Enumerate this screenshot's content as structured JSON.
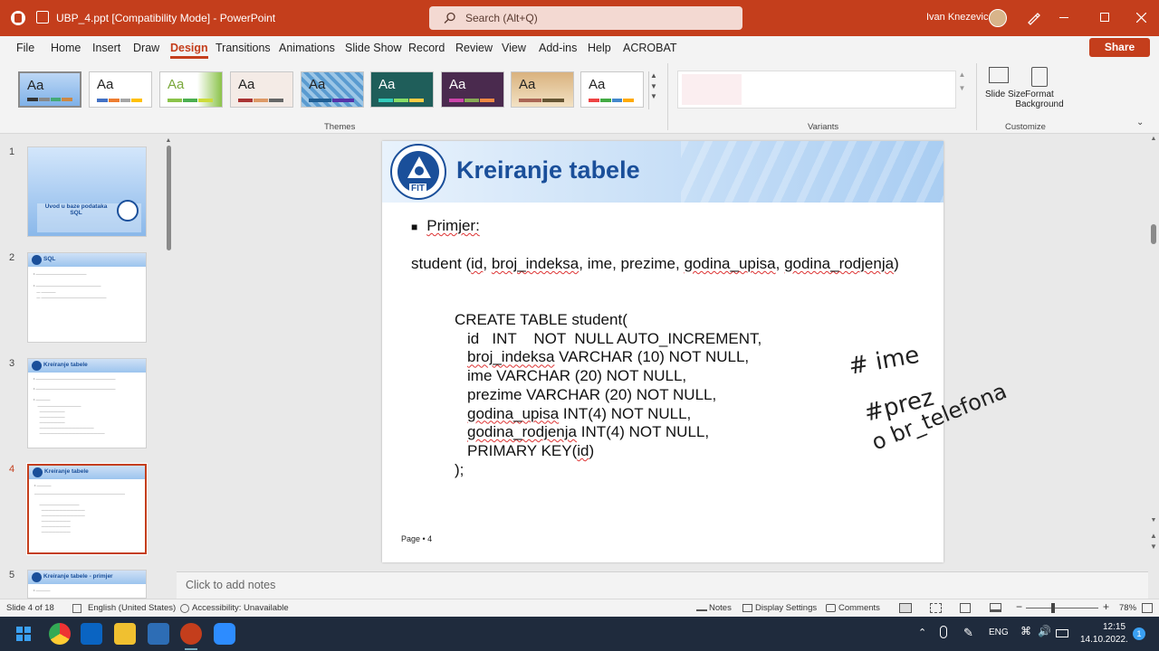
{
  "titlebar": {
    "file_name": "UBP_4.ppt [Compatibility Mode]",
    "separator": " - ",
    "app": "PowerPoint",
    "search_placeholder": "Search (Alt+Q)",
    "user": "Ivan Knezevic"
  },
  "ribbon_tabs": [
    "File",
    "Home",
    "Insert",
    "Draw",
    "Design",
    "Transitions",
    "Animations",
    "Slide Show",
    "Record",
    "Review",
    "View",
    "Add-ins",
    "Help",
    "ACROBAT"
  ],
  "active_tab": "Design",
  "share_label": "Share",
  "ribbon": {
    "themes_label": "Themes",
    "variants_label": "Variants",
    "customize_label": "Customize",
    "theme_sample": "Aa",
    "slide_size": "Slide Size",
    "format_background_1": "Format",
    "format_background_2": "Background"
  },
  "thumbnails": [
    {
      "num": "1",
      "title": "Uvod u baze podataka SQL"
    },
    {
      "num": "2",
      "title": "SQL"
    },
    {
      "num": "3",
      "title": "Kreiranje tabele"
    },
    {
      "num": "4",
      "title": "Kreiranje tabele"
    },
    {
      "num": "5",
      "title": "Kreiranje tabele - primjer"
    }
  ],
  "slide": {
    "title": "Kreiranje tabele",
    "bullet": "Primjer:",
    "student_line_parts": [
      "student (",
      "id",
      ", ",
      "broj_indeksa",
      ", ime, prezime, ",
      "godina_upisa",
      ", ",
      "godina_rodjenja",
      ")"
    ],
    "code": {
      "l1": "CREATE TABLE student(",
      "l2": "id   INT    NOT  NULL AUTO_INCREMENT,",
      "l3a": "broj_indeksa",
      "l3b": " VARCHAR (10) NOT NULL,",
      "l4": "ime VARCHAR (20) NOT NULL,",
      "l5": "prezime VARCHAR (20) NOT NULL,",
      "l6a": "godina_upisa",
      "l6b": " INT(4) NOT NULL,",
      "l7a": "godina_rodjenja",
      "l7b": " INT(4) NOT NULL,",
      "l8a": "PRIMARY KEY(",
      "l8b": "id",
      "l8c": ")",
      "l9": ");"
    },
    "page": "Page • 4",
    "handwriting": [
      "# ime",
      "#prez",
      "o br_telefona"
    ],
    "logo_text": "FIT"
  },
  "notes_placeholder": "Click to add notes",
  "status": {
    "slide": "Slide 4 of 18",
    "language": "English (United States)",
    "accessibility": "Accessibility: Unavailable",
    "notes": "Notes",
    "display_settings": "Display Settings",
    "comments": "Comments",
    "zoom": "78%"
  },
  "taskbar": {
    "lang": "ENG",
    "time": "12:15",
    "date": "14.10.2022.",
    "notif_count": "1"
  },
  "colors": {
    "accent": "#c43e1c",
    "slide_title": "#1a4f9a"
  }
}
